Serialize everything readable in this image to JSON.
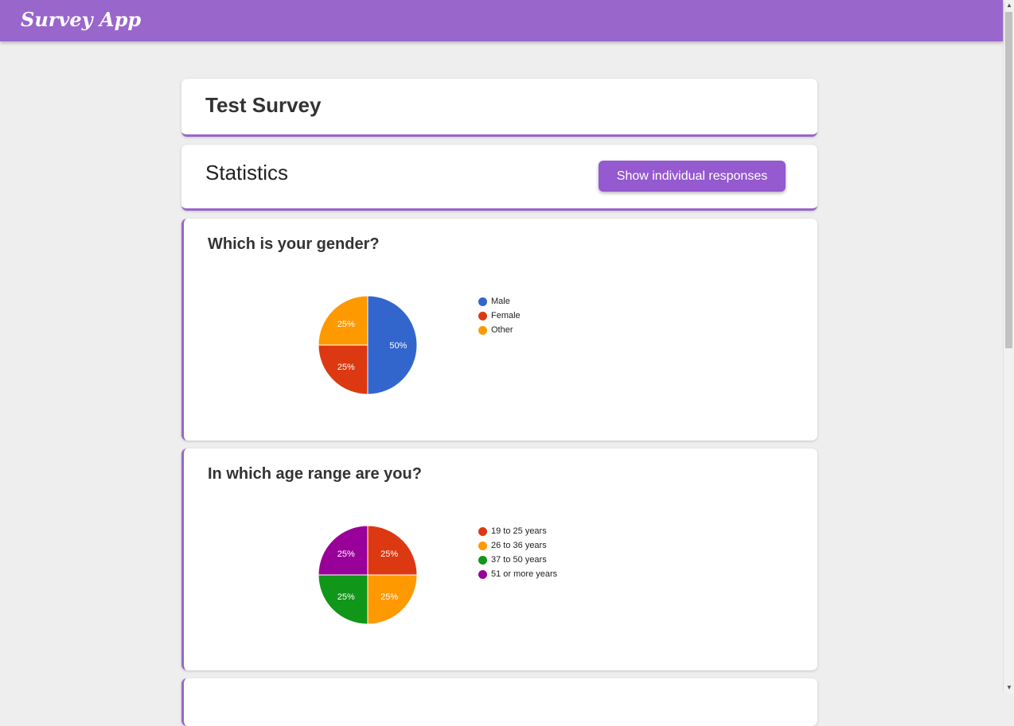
{
  "app": {
    "title": "Survey App"
  },
  "survey": {
    "title": "Test Survey"
  },
  "statistics": {
    "heading": "Statistics",
    "show_responses_label": "Show individual responses"
  },
  "questions": [
    {
      "title": "Which is your gender?",
      "chart_data": {
        "type": "pie",
        "categories": [
          "Male",
          "Female",
          "Other"
        ],
        "values": [
          50,
          25,
          25
        ],
        "value_labels": [
          "50%",
          "25%",
          "25%"
        ],
        "colors": [
          "#3366cc",
          "#dc3912",
          "#ff9900"
        ],
        "legend_position": "right"
      }
    },
    {
      "title": "In which age range are you?",
      "chart_data": {
        "type": "pie",
        "categories": [
          "19 to 25 years",
          "26 to 36 years",
          "37 to 50 years",
          "51 or more years"
        ],
        "values": [
          25,
          25,
          25,
          25
        ],
        "value_labels": [
          "25%",
          "25%",
          "25%",
          "25%"
        ],
        "colors": [
          "#dc3912",
          "#ff9900",
          "#109618",
          "#990099"
        ],
        "legend_position": "right"
      }
    }
  ]
}
